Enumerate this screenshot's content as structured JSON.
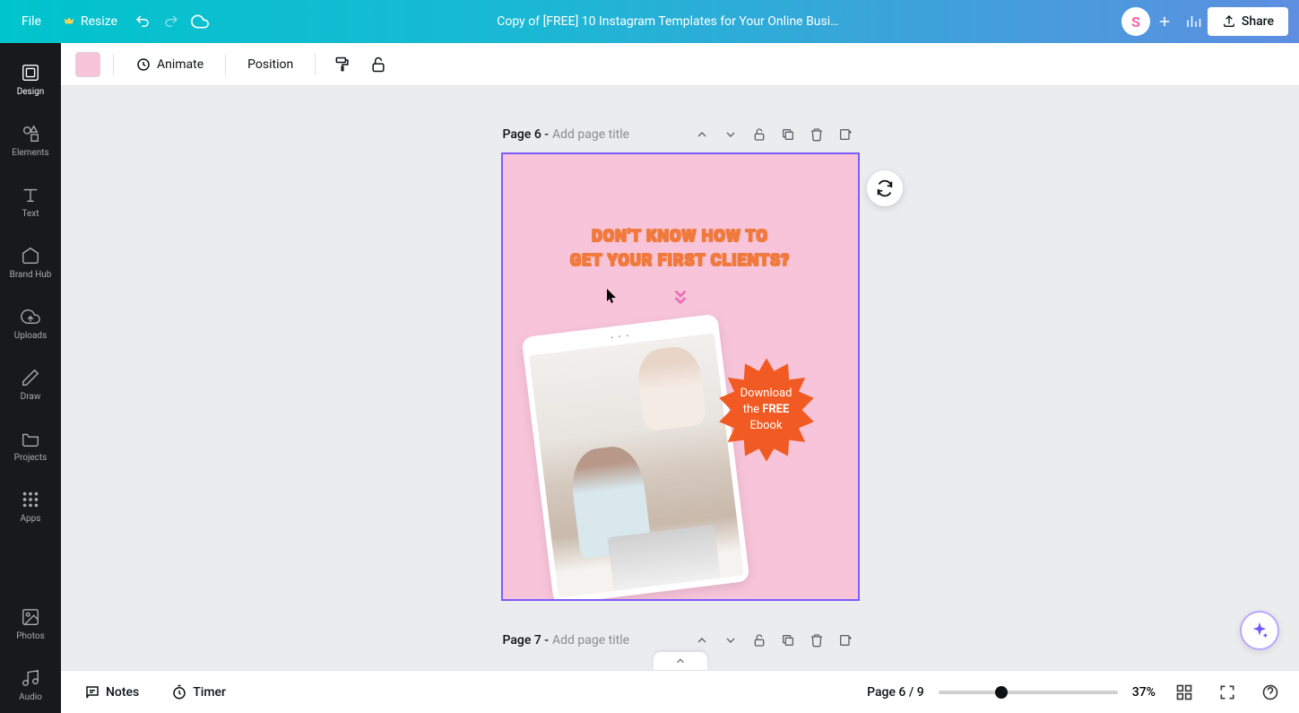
{
  "header": {
    "file": "File",
    "resize": "Resize",
    "title": "Copy of [FREE] 10 Instagram Templates for Your Online Busi…",
    "avatar": "S",
    "share": "Share"
  },
  "sidebar": {
    "items": [
      {
        "label": "Design"
      },
      {
        "label": "Elements"
      },
      {
        "label": "Text"
      },
      {
        "label": "Brand Hub"
      },
      {
        "label": "Uploads"
      },
      {
        "label": "Draw"
      },
      {
        "label": "Projects"
      },
      {
        "label": "Apps"
      }
    ],
    "lower": [
      {
        "label": "Photos"
      },
      {
        "label": "Audio"
      }
    ]
  },
  "toolbar": {
    "animate": "Animate",
    "position": "Position"
  },
  "page6": {
    "num": "Page 6 - ",
    "titlePlaceholder": "Add page title",
    "headline1": "DON'T KNOW HOW TO",
    "headline2": "GET YOUR FIRST CLIENTS?",
    "burst1": "Download",
    "burst2": "the ",
    "burst2b": "FREE",
    "burst3": "Ebook"
  },
  "page7": {
    "num": "Page 7 - ",
    "titlePlaceholder": "Add page title"
  },
  "bottom": {
    "notes": "Notes",
    "timer": "Timer",
    "pageInd": "Page 6 / 9",
    "zoom": "37%"
  },
  "colors": {
    "swatch": "#f8c4d9",
    "burst": "#f15a22"
  }
}
